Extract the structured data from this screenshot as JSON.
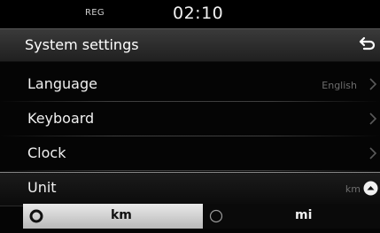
{
  "status_bar": {
    "mode": "REG",
    "time": "02:10"
  },
  "header": {
    "title": "System settings",
    "back_icon": "back-return-icon"
  },
  "menu": {
    "items": [
      {
        "label": "Language",
        "value": "English",
        "icon": "chevron-right-icon"
      },
      {
        "label": "Keyboard",
        "value": "",
        "icon": "chevron-right-icon"
      },
      {
        "label": "Clock",
        "value": "",
        "icon": "chevron-right-icon"
      }
    ],
    "expanded_item": {
      "label": "Unit",
      "value": "km",
      "icon": "chevron-up-circle-icon"
    }
  },
  "unit_options": [
    {
      "label": "km",
      "selected": true
    },
    {
      "label": "mi",
      "selected": false
    }
  ],
  "colors": {
    "background": "#050505",
    "header_top": "#3a3a3a",
    "selected_option": "#d6d6d6",
    "muted_text": "#6d6d6d"
  }
}
